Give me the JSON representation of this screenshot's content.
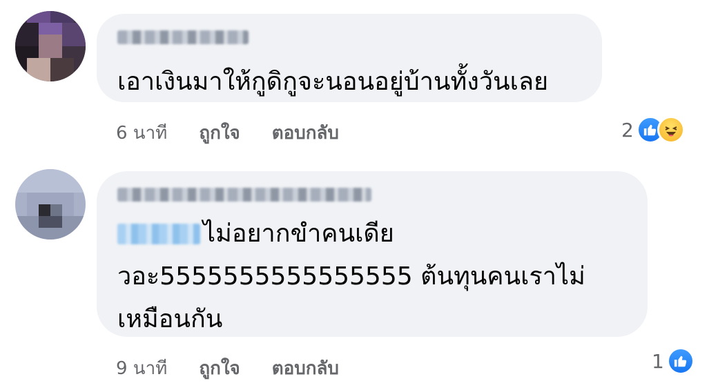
{
  "comments": [
    {
      "body": "เอาเงินมาให้กูดิกูจะนอนอยู่บ้านทั้งวันเลย",
      "time": "6 นาที",
      "like_label": "ถูกใจ",
      "reply_label": "ตอบกลับ",
      "reaction_count": "2",
      "reactions": [
        "like-icon",
        "haha-icon"
      ]
    },
    {
      "body_lines": [
        "ไม่อยากขำคนเดีย",
        "วอะ5555555555555555 ต้นทุนคนเราไม่",
        "เหมือนกัน"
      ],
      "time": "9 นาที",
      "like_label": "ถูกใจ",
      "reply_label": "ตอบกลับ",
      "reaction_count": "1",
      "reactions": [
        "like-icon"
      ]
    }
  ],
  "colors": {
    "bubble": "#f0f2f5",
    "meta_text": "#65676b",
    "like_blue": "#1877f2",
    "haha_yellow": "#f7b125"
  }
}
